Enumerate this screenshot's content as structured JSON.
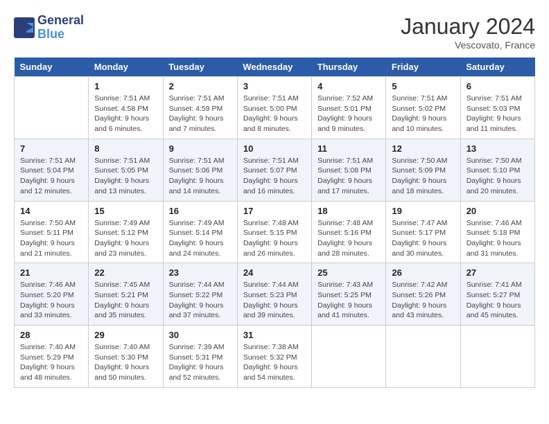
{
  "header": {
    "logo_line1": "General",
    "logo_line2": "Blue",
    "month": "January 2024",
    "location": "Vescovato, France"
  },
  "weekdays": [
    "Sunday",
    "Monday",
    "Tuesday",
    "Wednesday",
    "Thursday",
    "Friday",
    "Saturday"
  ],
  "weeks": [
    [
      {
        "num": "",
        "info": ""
      },
      {
        "num": "1",
        "info": "Sunrise: 7:51 AM\nSunset: 4:58 PM\nDaylight: 9 hours\nand 6 minutes."
      },
      {
        "num": "2",
        "info": "Sunrise: 7:51 AM\nSunset: 4:59 PM\nDaylight: 9 hours\nand 7 minutes."
      },
      {
        "num": "3",
        "info": "Sunrise: 7:51 AM\nSunset: 5:00 PM\nDaylight: 9 hours\nand 8 minutes."
      },
      {
        "num": "4",
        "info": "Sunrise: 7:52 AM\nSunset: 5:01 PM\nDaylight: 9 hours\nand 9 minutes."
      },
      {
        "num": "5",
        "info": "Sunrise: 7:51 AM\nSunset: 5:02 PM\nDaylight: 9 hours\nand 10 minutes."
      },
      {
        "num": "6",
        "info": "Sunrise: 7:51 AM\nSunset: 5:03 PM\nDaylight: 9 hours\nand 11 minutes."
      }
    ],
    [
      {
        "num": "7",
        "info": "Sunrise: 7:51 AM\nSunset: 5:04 PM\nDaylight: 9 hours\nand 12 minutes."
      },
      {
        "num": "8",
        "info": "Sunrise: 7:51 AM\nSunset: 5:05 PM\nDaylight: 9 hours\nand 13 minutes."
      },
      {
        "num": "9",
        "info": "Sunrise: 7:51 AM\nSunset: 5:06 PM\nDaylight: 9 hours\nand 14 minutes."
      },
      {
        "num": "10",
        "info": "Sunrise: 7:51 AM\nSunset: 5:07 PM\nDaylight: 9 hours\nand 16 minutes."
      },
      {
        "num": "11",
        "info": "Sunrise: 7:51 AM\nSunset: 5:08 PM\nDaylight: 9 hours\nand 17 minutes."
      },
      {
        "num": "12",
        "info": "Sunrise: 7:50 AM\nSunset: 5:09 PM\nDaylight: 9 hours\nand 18 minutes."
      },
      {
        "num": "13",
        "info": "Sunrise: 7:50 AM\nSunset: 5:10 PM\nDaylight: 9 hours\nand 20 minutes."
      }
    ],
    [
      {
        "num": "14",
        "info": "Sunrise: 7:50 AM\nSunset: 5:11 PM\nDaylight: 9 hours\nand 21 minutes."
      },
      {
        "num": "15",
        "info": "Sunrise: 7:49 AM\nSunset: 5:12 PM\nDaylight: 9 hours\nand 23 minutes."
      },
      {
        "num": "16",
        "info": "Sunrise: 7:49 AM\nSunset: 5:14 PM\nDaylight: 9 hours\nand 24 minutes."
      },
      {
        "num": "17",
        "info": "Sunrise: 7:48 AM\nSunset: 5:15 PM\nDaylight: 9 hours\nand 26 minutes."
      },
      {
        "num": "18",
        "info": "Sunrise: 7:48 AM\nSunset: 5:16 PM\nDaylight: 9 hours\nand 28 minutes."
      },
      {
        "num": "19",
        "info": "Sunrise: 7:47 AM\nSunset: 5:17 PM\nDaylight: 9 hours\nand 30 minutes."
      },
      {
        "num": "20",
        "info": "Sunrise: 7:46 AM\nSunset: 5:18 PM\nDaylight: 9 hours\nand 31 minutes."
      }
    ],
    [
      {
        "num": "21",
        "info": "Sunrise: 7:46 AM\nSunset: 5:20 PM\nDaylight: 9 hours\nand 33 minutes."
      },
      {
        "num": "22",
        "info": "Sunrise: 7:45 AM\nSunset: 5:21 PM\nDaylight: 9 hours\nand 35 minutes."
      },
      {
        "num": "23",
        "info": "Sunrise: 7:44 AM\nSunset: 5:22 PM\nDaylight: 9 hours\nand 37 minutes."
      },
      {
        "num": "24",
        "info": "Sunrise: 7:44 AM\nSunset: 5:23 PM\nDaylight: 9 hours\nand 39 minutes."
      },
      {
        "num": "25",
        "info": "Sunrise: 7:43 AM\nSunset: 5:25 PM\nDaylight: 9 hours\nand 41 minutes."
      },
      {
        "num": "26",
        "info": "Sunrise: 7:42 AM\nSunset: 5:26 PM\nDaylight: 9 hours\nand 43 minutes."
      },
      {
        "num": "27",
        "info": "Sunrise: 7:41 AM\nSunset: 5:27 PM\nDaylight: 9 hours\nand 45 minutes."
      }
    ],
    [
      {
        "num": "28",
        "info": "Sunrise: 7:40 AM\nSunset: 5:29 PM\nDaylight: 9 hours\nand 48 minutes."
      },
      {
        "num": "29",
        "info": "Sunrise: 7:40 AM\nSunset: 5:30 PM\nDaylight: 9 hours\nand 50 minutes."
      },
      {
        "num": "30",
        "info": "Sunrise: 7:39 AM\nSunset: 5:31 PM\nDaylight: 9 hours\nand 52 minutes."
      },
      {
        "num": "31",
        "info": "Sunrise: 7:38 AM\nSunset: 5:32 PM\nDaylight: 9 hours\nand 54 minutes."
      },
      {
        "num": "",
        "info": ""
      },
      {
        "num": "",
        "info": ""
      },
      {
        "num": "",
        "info": ""
      }
    ]
  ]
}
